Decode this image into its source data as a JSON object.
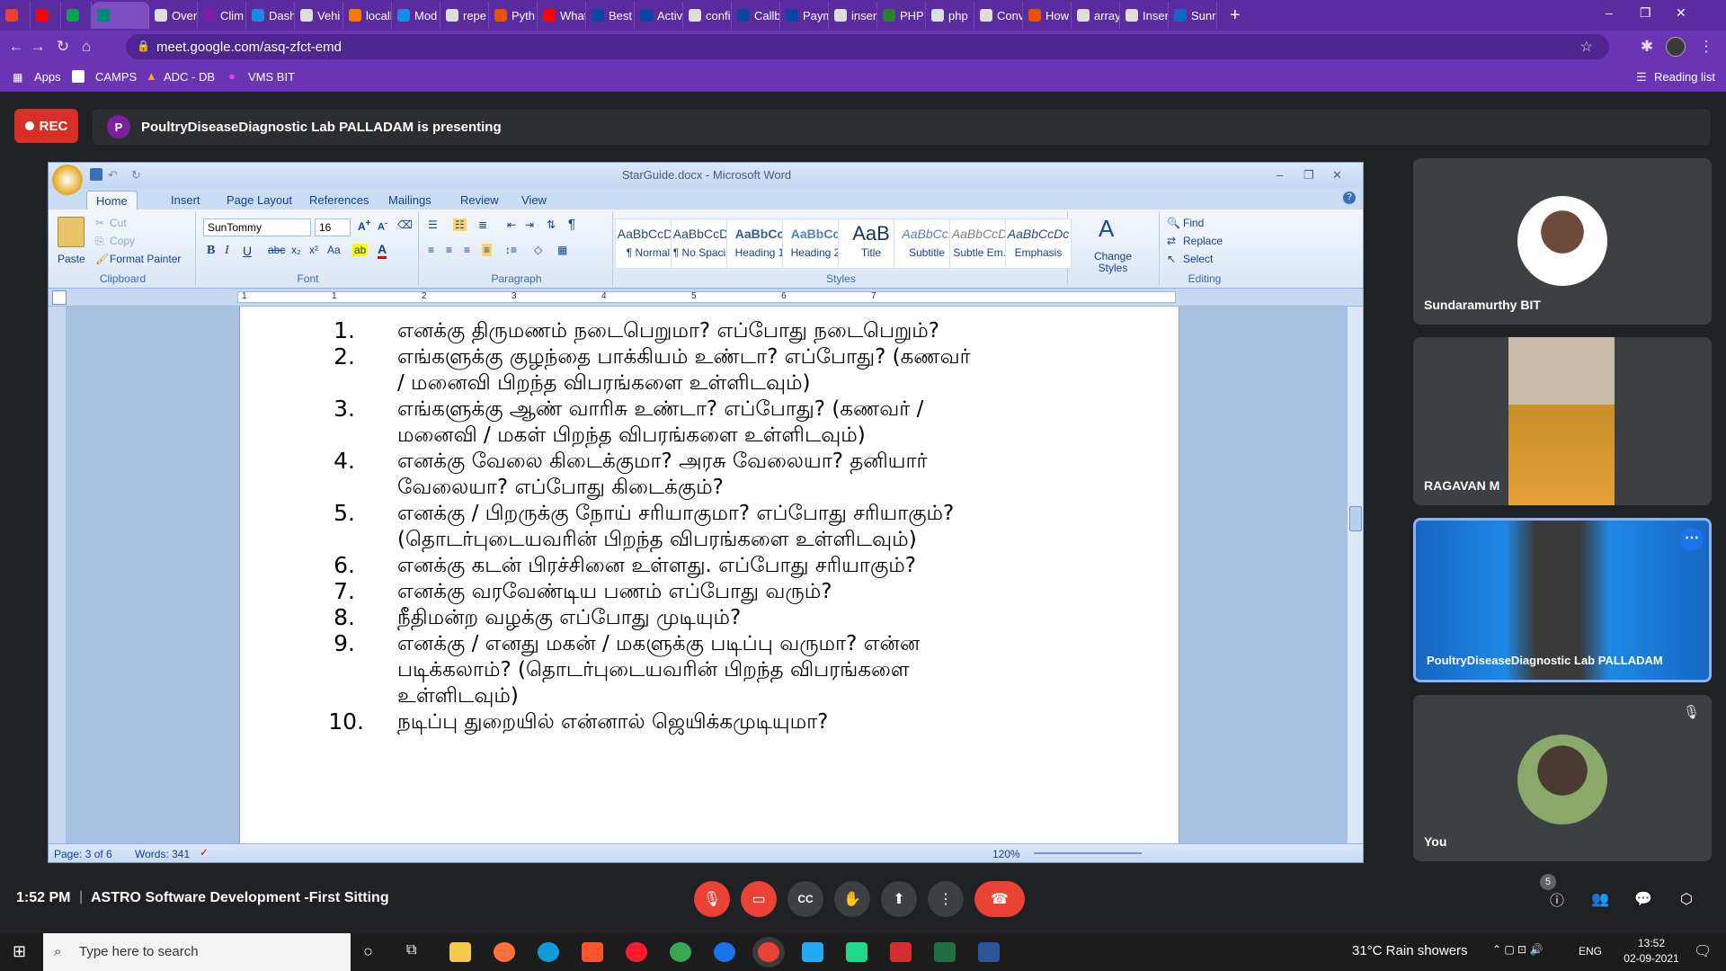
{
  "browser": {
    "tabs": [
      {
        "label": "",
        "color": "#ea4335"
      },
      {
        "label": "",
        "color": "#ff0000"
      },
      {
        "label": "",
        "color": "#0f9d58"
      },
      {
        "label": "",
        "color": "#00897b"
      },
      {
        "label": "Over",
        "color": "#dddddd"
      },
      {
        "label": "Clim",
        "color": "#7b1fa2"
      },
      {
        "label": "Dash",
        "color": "#1e88e5"
      },
      {
        "label": "Vehi",
        "color": "#dddddd"
      },
      {
        "label": "locall",
        "color": "#f57c00"
      },
      {
        "label": "Mod",
        "color": "#1e88e5"
      },
      {
        "label": "repe",
        "color": "#dddddd"
      },
      {
        "label": "Pyth",
        "color": "#e65100"
      },
      {
        "label": "What",
        "color": "#ff0000"
      },
      {
        "label": "Best",
        "color": "#0d47a1"
      },
      {
        "label": "Activ",
        "color": "#0d47a1"
      },
      {
        "label": "confi",
        "color": "#dddddd"
      },
      {
        "label": "Callb",
        "color": "#0d47a1"
      },
      {
        "label": "Paym",
        "color": "#0d47a1"
      },
      {
        "label": "inser",
        "color": "#dddddd"
      },
      {
        "label": "PHP",
        "color": "#2e7d32"
      },
      {
        "label": "php",
        "color": "#dddddd"
      },
      {
        "label": "Conv",
        "color": "#dddddd"
      },
      {
        "label": "How",
        "color": "#e65100"
      },
      {
        "label": "array",
        "color": "#dddddd"
      },
      {
        "label": "Inser",
        "color": "#dddddd"
      },
      {
        "label": "Sunr",
        "color": "#1565c0"
      }
    ],
    "url": "meet.google.com/asq-zfct-emd",
    "bookmarks": [
      "Apps",
      "CAMPS",
      "ADC - DB",
      "VMS BIT"
    ],
    "reading_list": "Reading list"
  },
  "meet": {
    "rec": "REC",
    "presenter_initial": "P",
    "presenting_text": "PoultryDiseaseDiagnostic Lab PALLADAM is presenting",
    "time": "1:52 PM",
    "separator": "|",
    "meeting_title": "ASTRO Software Development -First Sitting",
    "participant_count": "5",
    "participants": [
      {
        "name": "Sundaramurthy BIT"
      },
      {
        "name": "RAGAVAN M"
      },
      {
        "name": "PoultryDiseaseDiagnostic Lab PALLADAM"
      },
      {
        "name": "You"
      }
    ]
  },
  "word": {
    "title": "StarGuide.docx - Microsoft Word",
    "tabs": [
      "Home",
      "Insert",
      "Page Layout",
      "References",
      "Mailings",
      "Review",
      "View"
    ],
    "clipboard": {
      "paste": "Paste",
      "cut": "Cut",
      "copy": "Copy",
      "format_painter": "Format Painter",
      "label": "Clipboard"
    },
    "font": {
      "name": "SunTommy",
      "size": "16",
      "label": "Font"
    },
    "paragraph_label": "Paragraph",
    "styles": [
      {
        "sample": "AaBbCcDc",
        "name": "¶ Normal"
      },
      {
        "sample": "AaBbCcDc",
        "name": "¶ No Spaci..."
      },
      {
        "sample": "AaBbCc",
        "name": "Heading 1"
      },
      {
        "sample": "AaBbCc",
        "name": "Heading 2"
      },
      {
        "sample": "AaB",
        "name": "Title"
      },
      {
        "sample": "AaBbCc.",
        "name": "Subtitle"
      },
      {
        "sample": "AaBbCcDc",
        "name": "Subtle Em..."
      },
      {
        "sample": "AaBbCcDc",
        "name": "Emphasis"
      }
    ],
    "styles_label": "Styles",
    "change_styles": "Change Styles",
    "editing": {
      "find": "Find",
      "replace": "Replace",
      "select": "Select",
      "label": "Editing"
    },
    "ruler_numbers": [
      "1",
      "1",
      "2",
      "3",
      "4",
      "5",
      "6",
      "7"
    ],
    "items": [
      {
        "num": "1.",
        "lines": [
          "எனக்கு திருமணம் நடைபெறுமா? எப்போது நடைபெறும்?"
        ]
      },
      {
        "num": "2.",
        "lines": [
          "எங்களுக்கு குழந்தை பாக்கியம் உண்டா? எப்போது? (கணவர்",
          "/ மனைவி பிறந்த விபரங்களை உள்ளிடவும்)"
        ]
      },
      {
        "num": "3.",
        "lines": [
          "எங்களுக்கு ஆண் வாரிசு உண்டா? எப்போது? (கணவர் /",
          "மனைவி / மகள் பிறந்த விபரங்களை உள்ளிடவும்)"
        ]
      },
      {
        "num": "4.",
        "lines": [
          "எனக்கு வேலை கிடைக்குமா? அரசு வேலையா? தனியார்",
          "வேலையா? எப்போது கிடைக்கும்?"
        ]
      },
      {
        "num": "5.",
        "lines": [
          "எனக்கு / பிறருக்கு நோய் சரியாகுமா? எப்போது சரியாகும்?",
          "(தொடர்புடையவரின் பிறந்த விபரங்களை உள்ளிடவும்)"
        ]
      },
      {
        "num": "6.",
        "lines": [
          "எனக்கு கடன் பிரச்சினை உள்ளது. எப்போது சரியாகும்?"
        ]
      },
      {
        "num": "7.",
        "lines": [
          "எனக்கு வரவேண்டிய பணம் எப்போது வரும்?"
        ]
      },
      {
        "num": "8.",
        "lines": [
          "நீதிமன்ற வழக்கு எப்போது முடியும்?"
        ]
      },
      {
        "num": "9.",
        "lines": [
          "எனக்கு / எனது மகன் / மகளுக்கு படிப்பு வருமா? என்ன",
          "படிக்கலாம்? (தொடர்புடையவரின் பிறந்த விபரங்களை",
          "உள்ளிடவும்)"
        ]
      },
      {
        "num": "10.",
        "lines": [
          "நடிப்பு துறையில் என்னால் ஜெயிக்கமுடியுமா?"
        ]
      }
    ],
    "status": {
      "page": "Page: 3 of 6",
      "words": "Words: 341",
      "zoom": "120%"
    }
  },
  "taskbar": {
    "search_placeholder": "Type here to search",
    "weather": "31°C  Rain showers",
    "lang": "ENG",
    "time": "13:52",
    "date": "02-09-2021"
  },
  "colors": {
    "accent": "#5b2ca0",
    "rec": "#d93025",
    "end_call": "#ea4335",
    "word_blue": "#15428b"
  }
}
